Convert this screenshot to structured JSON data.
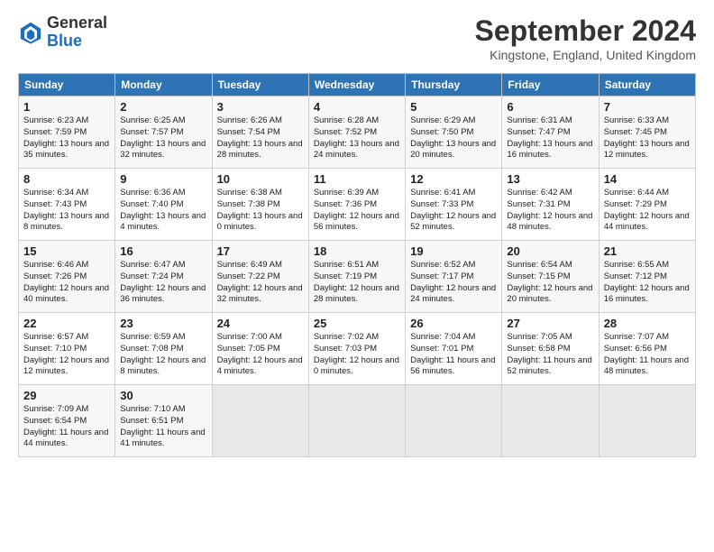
{
  "header": {
    "logo_general": "General",
    "logo_blue": "Blue",
    "month_title": "September 2024",
    "location": "Kingstone, England, United Kingdom"
  },
  "days_of_week": [
    "Sunday",
    "Monday",
    "Tuesday",
    "Wednesday",
    "Thursday",
    "Friday",
    "Saturday"
  ],
  "weeks": [
    [
      {
        "num": "1",
        "sunrise": "6:23 AM",
        "sunset": "7:59 PM",
        "daylight": "13 hours and 35 minutes."
      },
      {
        "num": "2",
        "sunrise": "6:25 AM",
        "sunset": "7:57 PM",
        "daylight": "13 hours and 32 minutes."
      },
      {
        "num": "3",
        "sunrise": "6:26 AM",
        "sunset": "7:54 PM",
        "daylight": "13 hours and 28 minutes."
      },
      {
        "num": "4",
        "sunrise": "6:28 AM",
        "sunset": "7:52 PM",
        "daylight": "13 hours and 24 minutes."
      },
      {
        "num": "5",
        "sunrise": "6:29 AM",
        "sunset": "7:50 PM",
        "daylight": "13 hours and 20 minutes."
      },
      {
        "num": "6",
        "sunrise": "6:31 AM",
        "sunset": "7:47 PM",
        "daylight": "13 hours and 16 minutes."
      },
      {
        "num": "7",
        "sunrise": "6:33 AM",
        "sunset": "7:45 PM",
        "daylight": "13 hours and 12 minutes."
      }
    ],
    [
      {
        "num": "8",
        "sunrise": "6:34 AM",
        "sunset": "7:43 PM",
        "daylight": "13 hours and 8 minutes."
      },
      {
        "num": "9",
        "sunrise": "6:36 AM",
        "sunset": "7:40 PM",
        "daylight": "13 hours and 4 minutes."
      },
      {
        "num": "10",
        "sunrise": "6:38 AM",
        "sunset": "7:38 PM",
        "daylight": "13 hours and 0 minutes."
      },
      {
        "num": "11",
        "sunrise": "6:39 AM",
        "sunset": "7:36 PM",
        "daylight": "12 hours and 56 minutes."
      },
      {
        "num": "12",
        "sunrise": "6:41 AM",
        "sunset": "7:33 PM",
        "daylight": "12 hours and 52 minutes."
      },
      {
        "num": "13",
        "sunrise": "6:42 AM",
        "sunset": "7:31 PM",
        "daylight": "12 hours and 48 minutes."
      },
      {
        "num": "14",
        "sunrise": "6:44 AM",
        "sunset": "7:29 PM",
        "daylight": "12 hours and 44 minutes."
      }
    ],
    [
      {
        "num": "15",
        "sunrise": "6:46 AM",
        "sunset": "7:26 PM",
        "daylight": "12 hours and 40 minutes."
      },
      {
        "num": "16",
        "sunrise": "6:47 AM",
        "sunset": "7:24 PM",
        "daylight": "12 hours and 36 minutes."
      },
      {
        "num": "17",
        "sunrise": "6:49 AM",
        "sunset": "7:22 PM",
        "daylight": "12 hours and 32 minutes."
      },
      {
        "num": "18",
        "sunrise": "6:51 AM",
        "sunset": "7:19 PM",
        "daylight": "12 hours and 28 minutes."
      },
      {
        "num": "19",
        "sunrise": "6:52 AM",
        "sunset": "7:17 PM",
        "daylight": "12 hours and 24 minutes."
      },
      {
        "num": "20",
        "sunrise": "6:54 AM",
        "sunset": "7:15 PM",
        "daylight": "12 hours and 20 minutes."
      },
      {
        "num": "21",
        "sunrise": "6:55 AM",
        "sunset": "7:12 PM",
        "daylight": "12 hours and 16 minutes."
      }
    ],
    [
      {
        "num": "22",
        "sunrise": "6:57 AM",
        "sunset": "7:10 PM",
        "daylight": "12 hours and 12 minutes."
      },
      {
        "num": "23",
        "sunrise": "6:59 AM",
        "sunset": "7:08 PM",
        "daylight": "12 hours and 8 minutes."
      },
      {
        "num": "24",
        "sunrise": "7:00 AM",
        "sunset": "7:05 PM",
        "daylight": "12 hours and 4 minutes."
      },
      {
        "num": "25",
        "sunrise": "7:02 AM",
        "sunset": "7:03 PM",
        "daylight": "12 hours and 0 minutes."
      },
      {
        "num": "26",
        "sunrise": "7:04 AM",
        "sunset": "7:01 PM",
        "daylight": "11 hours and 56 minutes."
      },
      {
        "num": "27",
        "sunrise": "7:05 AM",
        "sunset": "6:58 PM",
        "daylight": "11 hours and 52 minutes."
      },
      {
        "num": "28",
        "sunrise": "7:07 AM",
        "sunset": "6:56 PM",
        "daylight": "11 hours and 48 minutes."
      }
    ],
    [
      {
        "num": "29",
        "sunrise": "7:09 AM",
        "sunset": "6:54 PM",
        "daylight": "11 hours and 44 minutes."
      },
      {
        "num": "30",
        "sunrise": "7:10 AM",
        "sunset": "6:51 PM",
        "daylight": "11 hours and 41 minutes."
      },
      null,
      null,
      null,
      null,
      null
    ]
  ]
}
